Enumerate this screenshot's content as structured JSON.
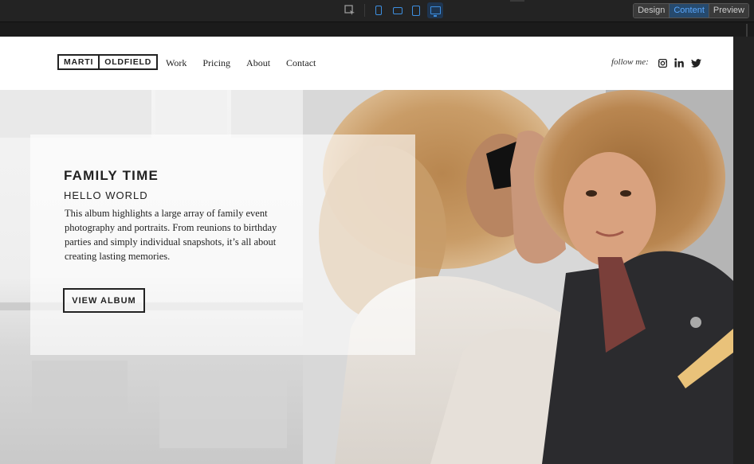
{
  "editor": {
    "modes": [
      "Design",
      "Content",
      "Preview"
    ],
    "active_mode": "Content",
    "toolbar_icons": [
      "inspect-icon",
      "phone-icon",
      "tablet-landscape-icon",
      "tablet-portrait-icon",
      "desktop-icon"
    ],
    "active_device": "desktop-icon",
    "accent_color": "#3d8fe0"
  },
  "site": {
    "logo": {
      "part1": "MARTI",
      "part2": "OLDFIELD"
    },
    "menu": [
      "Work",
      "Pricing",
      "About",
      "Contact"
    ],
    "follow_label": "follow me:",
    "social_icons": [
      "instagram-icon",
      "linkedin-icon",
      "twitter-icon"
    ]
  },
  "hero": {
    "title": "FAMILY TIME",
    "subtitle": "HELLO WORLD",
    "description": "This album highlights a large array of family event photography and portraits. From reunions to birthday parties and simply individual snapshots, it’s all about creating lasting memories.",
    "button_label": "VIEW ALBUM"
  }
}
